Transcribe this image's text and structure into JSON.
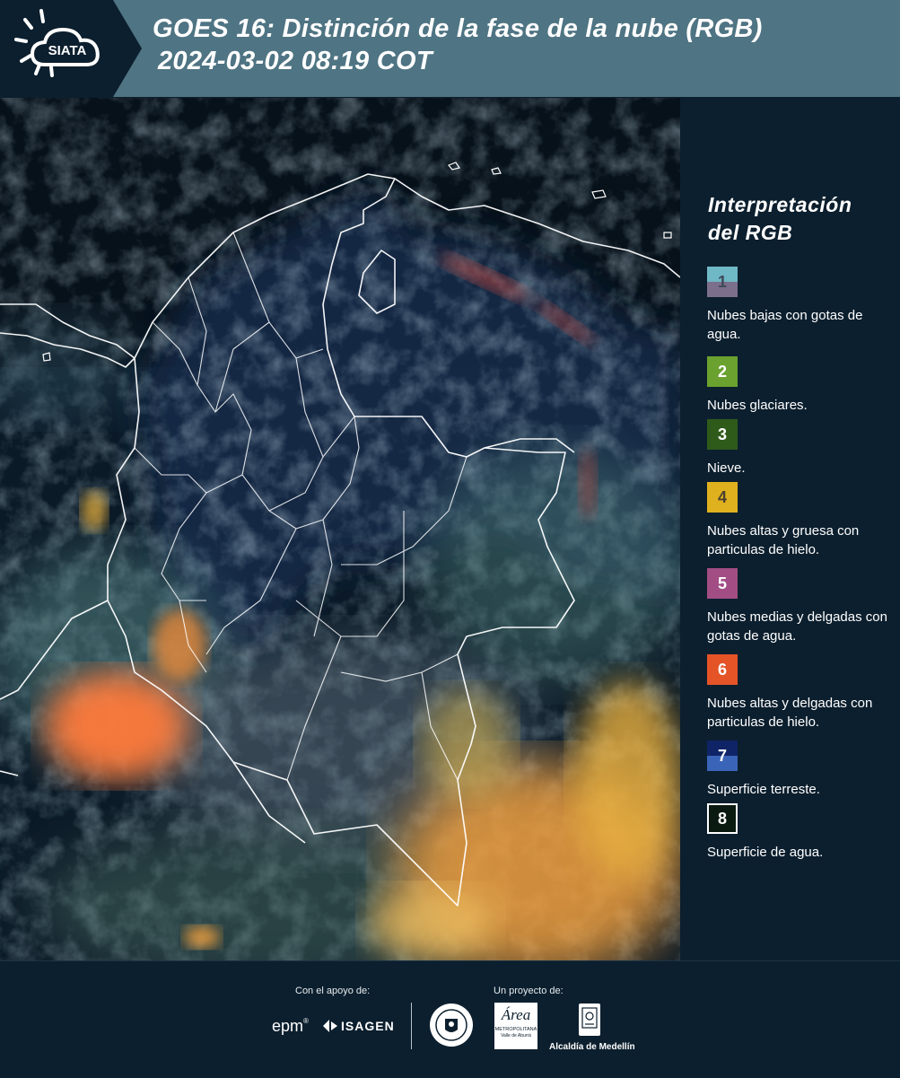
{
  "header": {
    "logo_text": "SIATA",
    "title_line1": "GOES 16: Distinción de la fase de la nube (RGB)",
    "title_line2": "2024-03-02 08:19 COT"
  },
  "legend": {
    "title_line1": "Interpretación",
    "title_line2": "del RGB",
    "items": [
      {
        "number": "1",
        "label": "Nubes bajas con gotas de agua.",
        "color_top": "#6fb8c6",
        "color_bottom": "#7b6f8c",
        "num_color": "#3e4a58"
      },
      {
        "number": "2",
        "label": "Nubes glaciares.",
        "color_top": "#6aa12f",
        "color_bottom": "#6aa12f",
        "num_color": "#ffffff"
      },
      {
        "number": "3",
        "label": "Nieve.",
        "color_top": "#2e5a1a",
        "color_bottom": "#2e5a1a",
        "num_color": "#ffffff"
      },
      {
        "number": "4",
        "label": "Nubes altas y gruesa con particulas de hielo.",
        "color_top": "#e0b11e",
        "color_bottom": "#e0b11e",
        "num_color": "#4a4130"
      },
      {
        "number": "5",
        "label": "Nubes medias y delgadas con gotas de agua.",
        "color_top": "#a24d84",
        "color_bottom": "#a24d84",
        "num_color": "#ffffff"
      },
      {
        "number": "6",
        "label": "Nubes altas y delgadas con particulas de hielo.",
        "color_top": "#e55427",
        "color_bottom": "#e55427",
        "num_color": "#ffffff"
      },
      {
        "number": "7",
        "label": "Superficie terreste.",
        "color_top": "#0f2466",
        "color_bottom": "#3a64b8",
        "num_color": "#ffffff"
      },
      {
        "number": "8",
        "label": "Superficie de agua.",
        "color_top": "#0a1a10",
        "color_bottom": "#0a1a10",
        "num_color": "#ffffff"
      }
    ]
  },
  "footer": {
    "support_label": "Con el apoyo de:",
    "project_label": "Un proyecto de:",
    "sponsor_1": "epm",
    "sponsor_2": "ISAGEN",
    "partner_area_1": "Área",
    "partner_area_2": "METROPOLITANA",
    "partner_area_3": "Valle de Aburrá",
    "partner_alcaldia": "Alcaldía de Medellín"
  }
}
